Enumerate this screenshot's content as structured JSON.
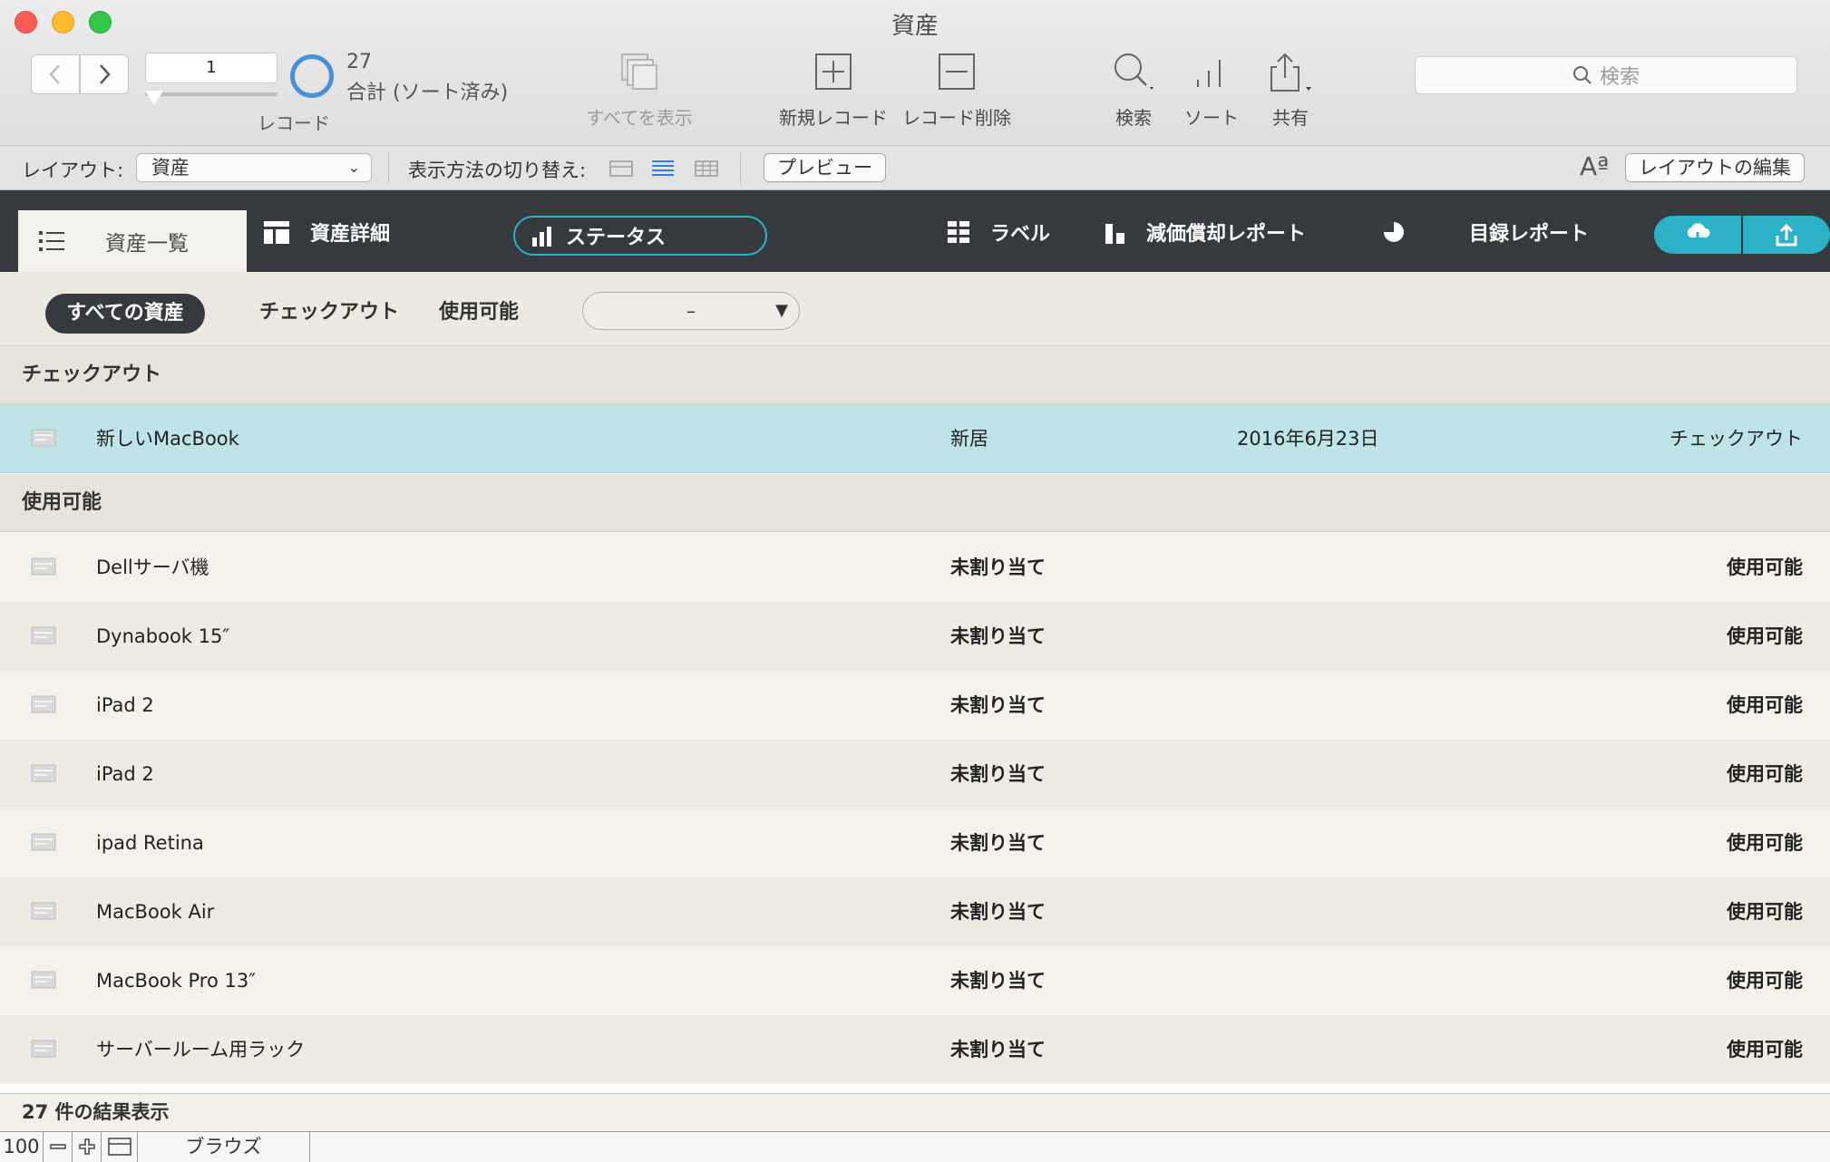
{
  "window": {
    "title": "資産"
  },
  "toolbar": {
    "record_value": "1",
    "record_label": "レコード",
    "count": "27",
    "count_sub": "合計 (ソート済み)",
    "show_all_label": "すべてを表示",
    "new_record_label": "新規レコード",
    "delete_record_label": "レコード削除",
    "find_label": "検索",
    "sort_label": "ソート",
    "share_label": "共有",
    "search_placeholder": "検索"
  },
  "layoutbar": {
    "layout_label": "レイアウト:",
    "layout_value": "資産",
    "view_switch_label": "表示方法の切り替え:",
    "preview_label": "プレビュー",
    "font_icon_text": "Aª",
    "edit_layout_label": "レイアウトの編集"
  },
  "tabs": {
    "asset_list": "資産一覧",
    "asset_detail": "資産詳細",
    "status": "ステータス",
    "labels": "ラベル",
    "depreciation": "減価償却レポート",
    "catalog": "目録レポート"
  },
  "filters": {
    "all": "すべての資産",
    "checked_out": "チェックアウト",
    "available": "使用可能",
    "dropdown_value": "–"
  },
  "groups": [
    {
      "title": "チェックアウト",
      "rows": [
        {
          "name": "新しいMacBook",
          "location": "新居",
          "date": "2016年6月23日",
          "status": "チェックアウト"
        }
      ]
    },
    {
      "title": "使用可能",
      "rows": [
        {
          "name": "Dellサーバ機",
          "location": "未割り当て",
          "date": "",
          "status": "使用可能"
        },
        {
          "name": "Dynabook 15″",
          "location": "未割り当て",
          "date": "",
          "status": "使用可能"
        },
        {
          "name": "iPad 2",
          "location": "未割り当て",
          "date": "",
          "status": "使用可能"
        },
        {
          "name": "iPad 2",
          "location": "未割り当て",
          "date": "",
          "status": "使用可能"
        },
        {
          "name": "ipad Retina",
          "location": "未割り当て",
          "date": "",
          "status": "使用可能"
        },
        {
          "name": "MacBook Air",
          "location": "未割り当て",
          "date": "",
          "status": "使用可能"
        },
        {
          "name": "MacBook Pro 13″",
          "location": "未割り当て",
          "date": "",
          "status": "使用可能"
        },
        {
          "name": "サーバールーム用ラック",
          "location": "未割り当て",
          "date": "",
          "status": "使用可能"
        }
      ]
    }
  ],
  "results": {
    "text": "27 件の結果表示"
  },
  "statusbar": {
    "zoom": "100",
    "mode": "ブラウズ"
  },
  "colors": {
    "accent": "#2bb2c7",
    "tabbar": "#36393d",
    "selected_row": "#bfe4e8"
  }
}
